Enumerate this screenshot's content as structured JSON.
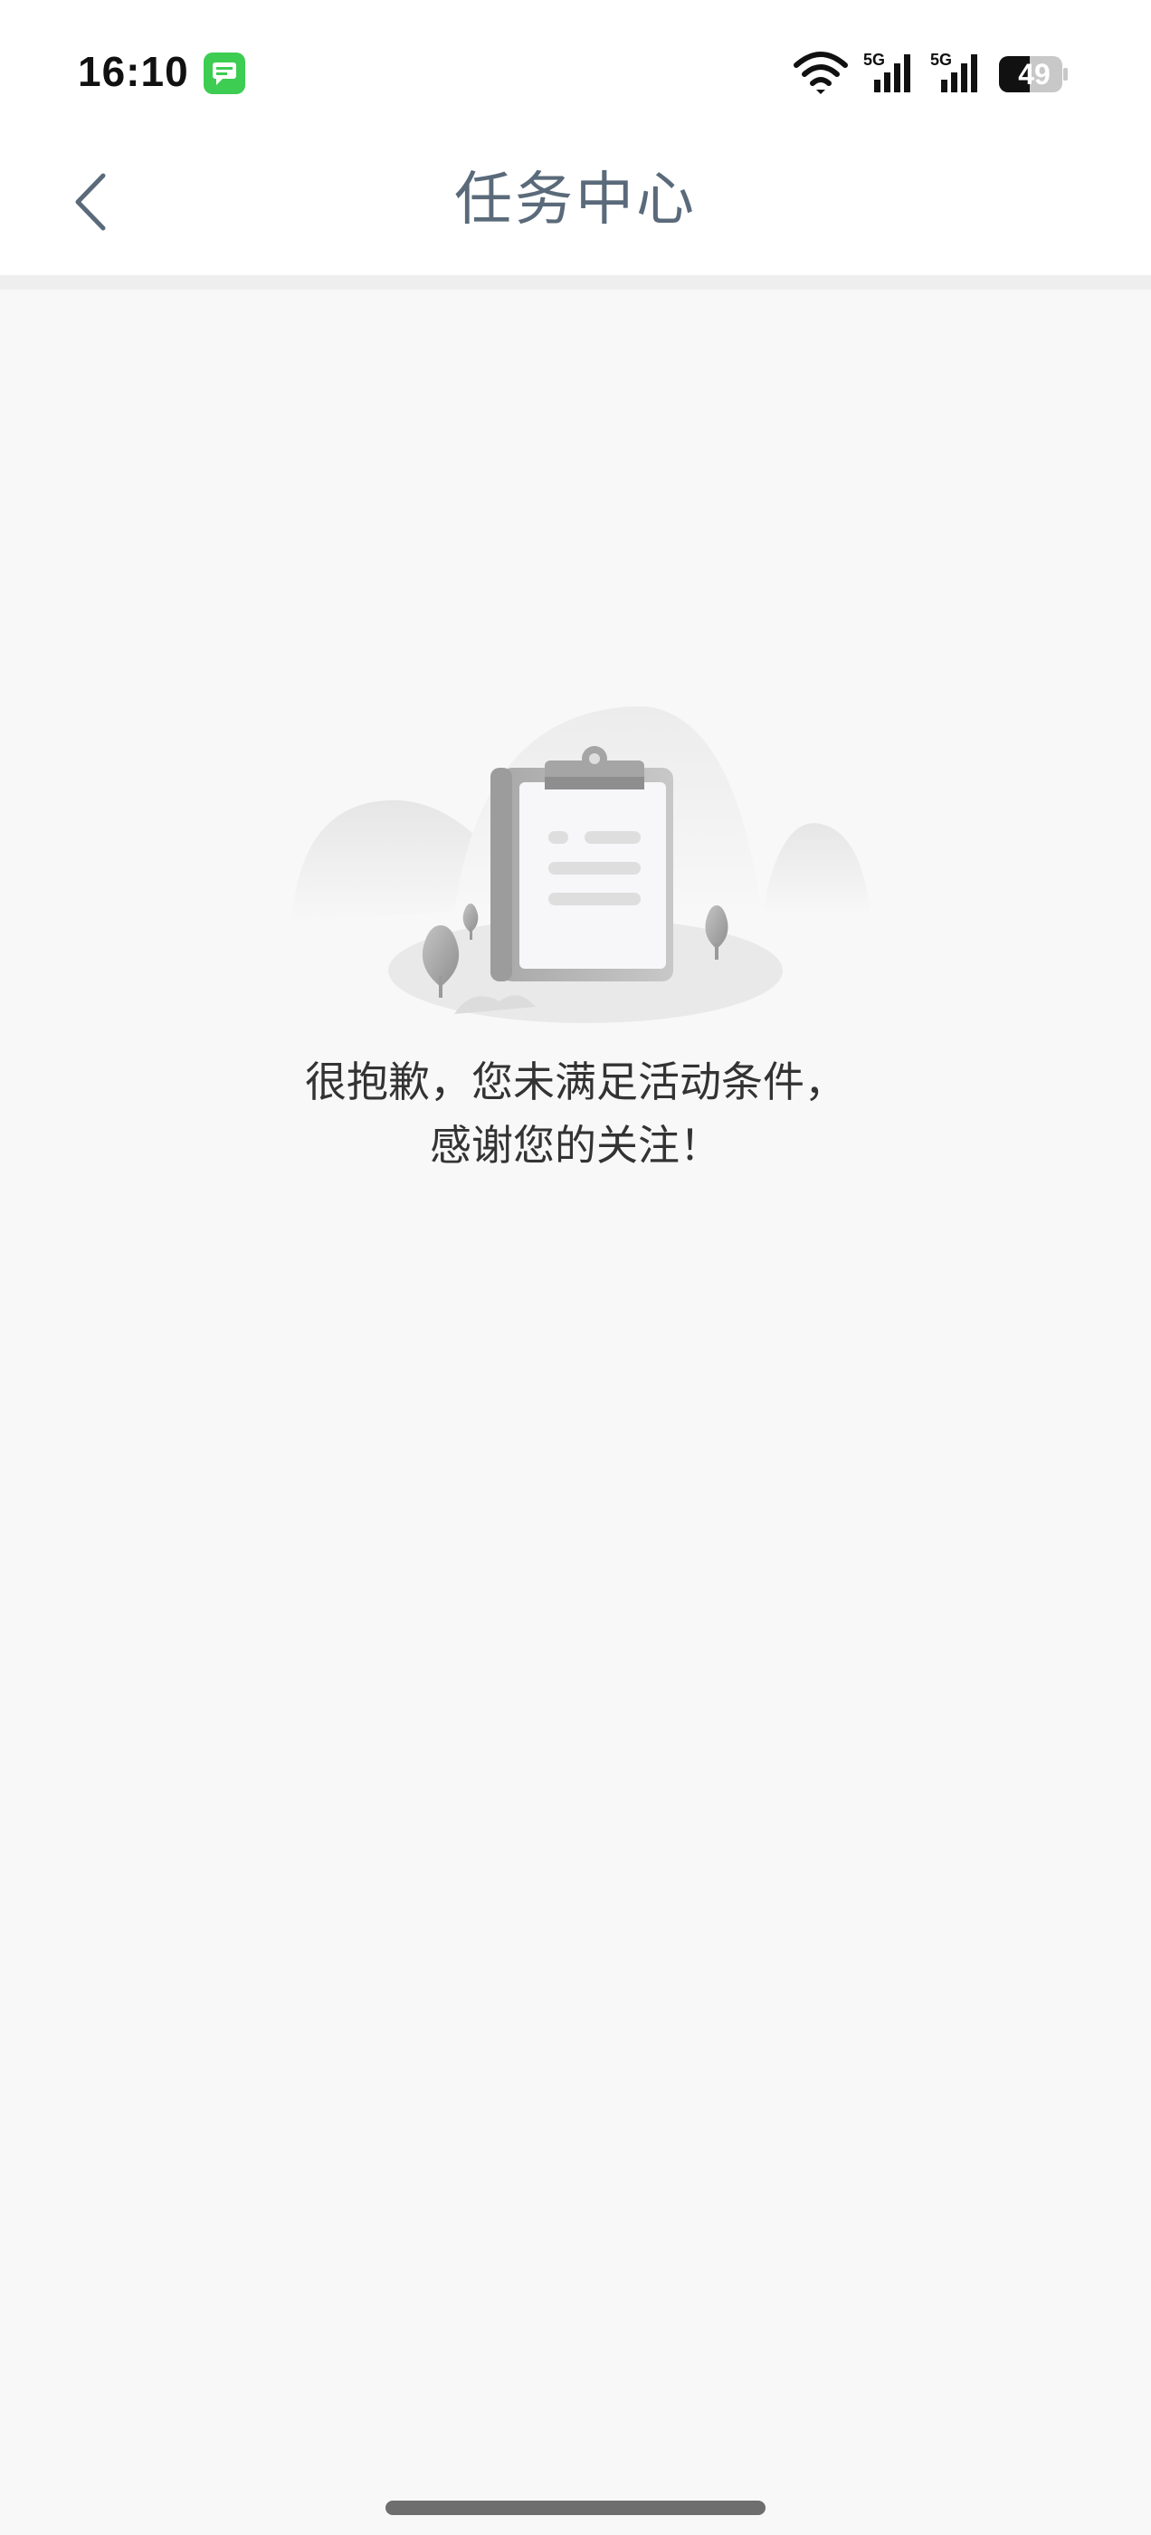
{
  "status_bar": {
    "time": "16:10",
    "battery": "49",
    "network_1": "5G",
    "network_2": "5G",
    "icons": [
      "messages-icon",
      "wifi-icon",
      "signal-icon",
      "signal-icon",
      "battery-icon"
    ]
  },
  "nav": {
    "title": "任务中心",
    "back_icon": "chevron-left-icon"
  },
  "empty_state": {
    "illustration": "clipboard-icon",
    "line1": "很抱歉，您未满足活动条件，",
    "line2": "感谢您的关注！"
  },
  "colors": {
    "background": "#f8f8f8",
    "title": "#5a6a7a",
    "text": "#333333",
    "accent_green": "#3ccd52"
  }
}
